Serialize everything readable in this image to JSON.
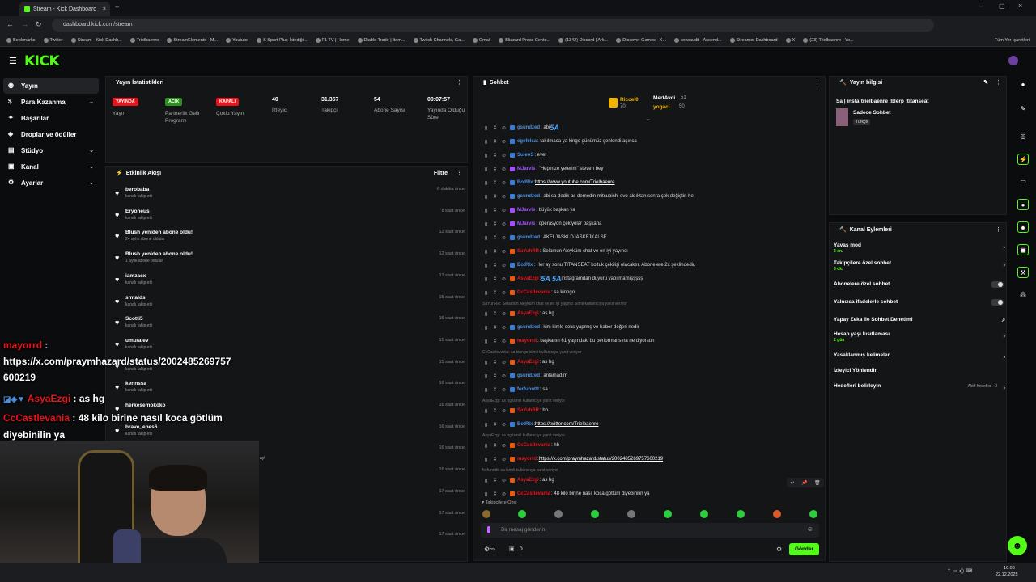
{
  "browser": {
    "tab_title": "Stream - Kick Dashboard",
    "url": "dashboard.kick.com/stream",
    "bookmarks": [
      "Bookmarks",
      "Twitter",
      "Stream - Kick Dashb...",
      "Trielbaenre",
      "StreamElements - M...",
      "Youtube",
      "S Sport Plus-İstediği...",
      "F1 TV | Home",
      "Diablo Trade | Item...",
      "Twitch Channels, Ga...",
      "Gmail",
      "Blizzard Press Cente...",
      "(1342) Discord | Ark...",
      "Discover Games - K...",
      "wowaudit - Ascend...",
      "Streamer Dashboard",
      "X",
      "(23) Trielbaenre - Yo..."
    ],
    "all_bookmarks": "Tüm Yer İşaretleri"
  },
  "logo": "KICK",
  "sidebar": {
    "items": [
      {
        "label": "Yayın",
        "active": true,
        "icon": "broadcast-icon"
      },
      {
        "label": "Para Kazanma",
        "chev": "⌄",
        "icon": "money-icon"
      },
      {
        "label": "Başarılar",
        "icon": "trophy-icon"
      },
      {
        "label": "Droplar ve ödüller",
        "icon": "gift-icon"
      },
      {
        "label": "Stüdyo",
        "chev": "⌄",
        "icon": "studio-icon"
      },
      {
        "label": "Kanal",
        "chev": "⌄",
        "icon": "channel-icon"
      },
      {
        "label": "Ayarlar",
        "chev": "⌄",
        "icon": "gear-icon"
      }
    ]
  },
  "stats": {
    "title": "Yayın İstatistikleri",
    "items": [
      {
        "badge": "YAYINDA",
        "badge_color": "#e8141c",
        "label": "Yayın"
      },
      {
        "badge": "AÇIK",
        "badge_color": "#2d8f1f",
        "label": "Partnerlik Gelir Programı"
      },
      {
        "badge": "KAPALI",
        "badge_color": "#e8141c",
        "label": "Çoklu Yayın"
      },
      {
        "value": "40",
        "label": "İzleyici"
      },
      {
        "value": "31.357",
        "label": "Takipçi"
      },
      {
        "value": "54",
        "label": "Abone Sayısı"
      },
      {
        "value": "00:07:57",
        "label": "Yayında Olduğu Süre"
      }
    ]
  },
  "activity": {
    "title": "Etkinlik Akışı",
    "filter": "Filtre",
    "rows": [
      {
        "name": "berobaba",
        "sub": "kanalı takip etti",
        "time": "6 dakika önce"
      },
      {
        "name": "Eryoneus",
        "sub": "kanalı takip etti",
        "time": "8 saat önce"
      },
      {
        "name": "Blush yeniden abone oldu!",
        "sub": "24 aylık abone oldular",
        "time": "12 saat önce"
      },
      {
        "name": "Blush yeniden abone oldu!",
        "sub": "1 aylık abone oldular",
        "time": "12 saat önce"
      },
      {
        "name": "iamzacx",
        "sub": "kanalı takip etti",
        "time": "12 saat önce"
      },
      {
        "name": "smtalds",
        "sub": "kanalı takip etti",
        "time": "15 saat önce"
      },
      {
        "name": "Scotti5",
        "sub": "kanalı takip etti",
        "time": "15 saat önce"
      },
      {
        "name": "umutalev",
        "sub": "kanalı takip etti",
        "time": "15 saat önce"
      },
      {
        "name": "",
        "sub": "kanalı takip etti",
        "time": "15 saat önce"
      },
      {
        "name": "kennssa",
        "sub": "kanalı takip etti",
        "time": "16 saat önce"
      },
      {
        "name": "herkesemokoko",
        "sub": "",
        "time": "16 saat önce"
      },
      {
        "name": "brave_enes6",
        "sub": "kanalı takip etti",
        "time": "16 saat önce"
      },
      {
        "name": "",
        "sub": "",
        "time": "16 saat önce"
      },
      {
        "name": "",
        "sub": "",
        "time": "16 saat önce"
      },
      {
        "name": "",
        "sub": "",
        "time": "17 saat önce"
      },
      {
        "name": "",
        "sub": "",
        "time": "17 saat önce"
      },
      {
        "name": "",
        "sub": "",
        "time": "17 saat önce"
      }
    ],
    "extra_text": "ay!"
  },
  "overlay": {
    "lines": [
      {
        "user": "mayorrd",
        "text": " :",
        "user_color": "#e8141c"
      },
      {
        "user": "",
        "text": "https://x.com/praymhazard/status/2002485269757"
      },
      {
        "user": "",
        "text": "600219"
      },
      {
        "user": "AsyaEzgi",
        "text": " : as hg",
        "user_color": "#e8141c"
      },
      {
        "user": "CcCastlevania",
        "text": " : 48 kilo birine nasıl koca götlüm",
        "user_color": "#e8141c"
      },
      {
        "user": "",
        "text": "diyebinilin ya"
      }
    ]
  },
  "chat": {
    "title": "Sohbet",
    "top_users": [
      {
        "name": "Ricceİ0",
        "count": "70"
      },
      {
        "name": "MertAvci",
        "count": "51"
      },
      {
        "name": "yogaci",
        "count": "50"
      }
    ],
    "lines": [
      {
        "user": "gsundzed",
        "color": "#4a90e2",
        "text": ": abi ",
        "extra": "5A"
      },
      {
        "user": "egefelsa",
        "color": "#4a90e2",
        "text": ": takılmaca ya kingo günümüz şenlendi açınca"
      },
      {
        "user": "SuleoS",
        "color": "#4a90e2",
        "text": ": evet"
      },
      {
        "user": "MJarvis",
        "color": "#a64dff",
        "text": ": \"Hepinize yeterim\" steven bey"
      },
      {
        "user": "BotRix",
        "color": "#4a90e2",
        "text": ": ",
        "link": "https://www.youtube.com/Trielbaenre"
      },
      {
        "user": "gsundzed",
        "color": "#4a90e2",
        "text": ": abi sa dedik as demedin mitsubishi evo aldıktan sonra çok değiştin he"
      },
      {
        "user": "MJarvis",
        "color": "#a64dff",
        "text": ": büyük başkan ya"
      },
      {
        "user": "MJarvis",
        "color": "#a64dff",
        "text": ": operasyon çekiyolar başkana"
      },
      {
        "user": "gsundzed",
        "color": "#4a90e2",
        "text": ": AKFLJASKLDJASKFJKALSF"
      },
      {
        "user": "SaYuhRR",
        "color": "#e8141c",
        "text": ": Selamun Aleyküm chat ve en iyi yayıncı"
      },
      {
        "user": "BotRix",
        "color": "#4a90e2",
        "text": ": Her ay sonu TITANSEAT koltuk çekilişi olacaktır. Abonelere 2x şeklindedir."
      },
      {
        "user": "AsyaEzgi",
        "color": "#e8141c",
        "text": ": ",
        "extra": "5A 5A",
        "text2": " instagramdan duyuru yapılmamışşşşş"
      },
      {
        "user": "CcCastlevania",
        "color": "#e8141c",
        "text": ": sa kinngo"
      },
      {
        "reply": "SaYuhRR: Selamun Aleyküm chat ve en iyi yayıncı isimli kullanıcıya yanıt veriyor"
      },
      {
        "user": "AsyaEzgi",
        "color": "#e8141c",
        "text": ": as hg"
      },
      {
        "user": "gsundzed",
        "color": "#4a90e2",
        "text": ": kim kimle seks yapmış ve haber değeri nedir"
      },
      {
        "user": "mayorrd",
        "color": "#e8141c",
        "text": ": başkanın 61 yaşındaki bu performansına ne diyorsun"
      },
      {
        "reply": "CcCastlevania: sa kinngo isimli kullanıcıya yanıt veriyor"
      },
      {
        "user": "AsyaEzgi",
        "color": "#e8141c",
        "text": ": as hg"
      },
      {
        "user": "gsundzed",
        "color": "#4a90e2",
        "text": ": anlamadım"
      },
      {
        "user": "forfunnttt",
        "color": "#4a90e2",
        "text": ": sa"
      },
      {
        "reply": "AsyaEzgi: as hg isimli kullanıcıya yanıt veriyor"
      },
      {
        "user": "SaYuhRR",
        "color": "#e8141c",
        "text": ": hb"
      },
      {
        "user": "BotRix",
        "color": "#4a90e2",
        "text": ": ",
        "link": "https://twitter.com/Trielbaenre"
      },
      {
        "reply": "AsyaEzgi: as hg isimli kullanıcıya yanıt veriyor"
      },
      {
        "user": "CcCastlevania",
        "color": "#e8141c",
        "text": ": hb"
      },
      {
        "user": "mayorrd",
        "color": "#e8141c",
        "text": ": ",
        "link": "https://x.com/praymhazard/status/2002485269757600219"
      },
      {
        "reply": "forfunnttt: sa isimli kullanıcıya yanıt veriyor"
      },
      {
        "user": "AsyaEzgi",
        "color": "#e8141c",
        "text": ": as hg"
      },
      {
        "user": "CcCastlevania",
        "color": "#e8141c",
        "text": ": 48 kilo birine nasıl koca götlüm diyebinilin ya"
      }
    ],
    "followers_only": "Takipçilere Özel",
    "input_placeholder": "Bir mesaj gönderin",
    "send": "Gönder",
    "count": "0"
  },
  "stream_info": {
    "title": "Yayın bilgisi",
    "stream_title": "Sa | insta:trielbaenre !blerp !titanseat",
    "category": "Sadece Sohbet",
    "language": "Türkçe"
  },
  "channel_actions": {
    "title": "Kanal Eylemleri",
    "rows": [
      {
        "label": "Yavaş mod",
        "sub": "3 sn.",
        "type": "arrow"
      },
      {
        "label": "Takipçilere özel sohbet",
        "sub": "6 dk.",
        "type": "arrow"
      },
      {
        "label": "Abonelere özel sohbet",
        "type": "toggle"
      },
      {
        "label": "Yalnızca ifadelerle sohbet",
        "type": "toggle"
      },
      {
        "label": "Yapay Zeka ile Sohbet Denetimi",
        "type": "ext"
      },
      {
        "label": "Hesap yaşı kısıtlaması",
        "sub": "2 gün",
        "type": "arrow"
      },
      {
        "label": "Yasaklanmış kelimeler",
        "type": "arrow"
      },
      {
        "label": "İzleyici Yönlendir",
        "type": "none"
      },
      {
        "label": "Hedefleri belirleyin",
        "right": "Aktif hedefler - 2",
        "type": "arrow"
      }
    ]
  },
  "taskbar": {
    "time": "16:03",
    "date": "22.12.2025"
  }
}
